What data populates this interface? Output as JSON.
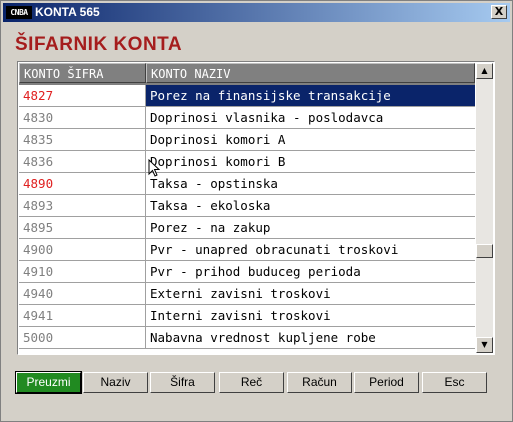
{
  "window": {
    "title": "KONTA  565",
    "icon_label": "CNBA",
    "close_label": "X"
  },
  "heading": "ŠIFARNIK KONTA",
  "table": {
    "columns": [
      "KONTO ŠIFRA",
      "KONTO NAZIV"
    ],
    "rows": [
      {
        "code": "4827",
        "name": "Porez na finansijske transakcije",
        "code_red": true,
        "selected": true
      },
      {
        "code": "4830",
        "name": "Doprinosi vlasnika - poslodavca",
        "code_red": false,
        "selected": false
      },
      {
        "code": "4835",
        "name": "Doprinosi komori A",
        "code_red": false,
        "selected": false
      },
      {
        "code": "4836",
        "name": "Doprinosi komori B",
        "code_red": false,
        "selected": false
      },
      {
        "code": "4890",
        "name": "Taksa - opstinska",
        "code_red": true,
        "selected": false
      },
      {
        "code": "4893",
        "name": "Taksa - ekoloska",
        "code_red": false,
        "selected": false
      },
      {
        "code": "4895",
        "name": "Porez - na zakup",
        "code_red": false,
        "selected": false
      },
      {
        "code": "4900",
        "name": "Pvr - unapred obracunati troskovi",
        "code_red": false,
        "selected": false
      },
      {
        "code": "4910",
        "name": "Pvr - prihod buduceg perioda",
        "code_red": false,
        "selected": false
      },
      {
        "code": "4940",
        "name": "Externi zavisni troskovi",
        "code_red": false,
        "selected": false
      },
      {
        "code": "4941",
        "name": "Interni zavisni troskovi",
        "code_red": false,
        "selected": false
      },
      {
        "code": "5000",
        "name": "Nabavna vrednost kupljene robe",
        "code_red": false,
        "selected": false
      }
    ]
  },
  "scrollbar": {
    "up": "▲",
    "down": "▼"
  },
  "buttons": {
    "preuzmi": "Preuzmi",
    "naziv": "Naziv",
    "sifra": "Šifra",
    "rec": "Reč",
    "racun": "Račun",
    "period": "Period",
    "esc": "Esc"
  },
  "colors": {
    "accent_red": "#a51d1d",
    "selection": "#0a246a",
    "primary_button": "#218a21",
    "code_red": "#e02020"
  }
}
